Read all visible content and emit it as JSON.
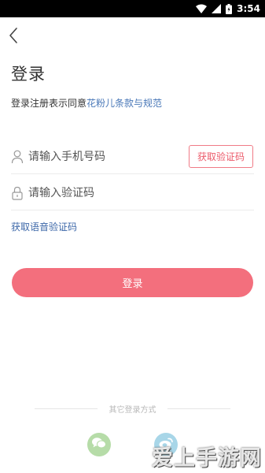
{
  "status_bar": {
    "time": "3:54"
  },
  "header": {
    "title": "登录"
  },
  "agreement": {
    "prefix": "登录注册表示同意",
    "link": "花粉儿条款与规范"
  },
  "phone_field": {
    "placeholder": "请输入手机号码",
    "get_code_label": "获取验证码"
  },
  "code_field": {
    "placeholder": "请输入验证码"
  },
  "voice_code_link": "获取语音验证码",
  "login_button": "登录",
  "other_login": {
    "label": "其它登录方式",
    "options": [
      "wechat-icon",
      "weibo-icon"
    ]
  },
  "watermark": "爱上手游网",
  "colors": {
    "accent": "#f36f7d",
    "link": "#4a78b8",
    "wechat": "#b6dca8",
    "weibo": "#a8d6e8"
  }
}
